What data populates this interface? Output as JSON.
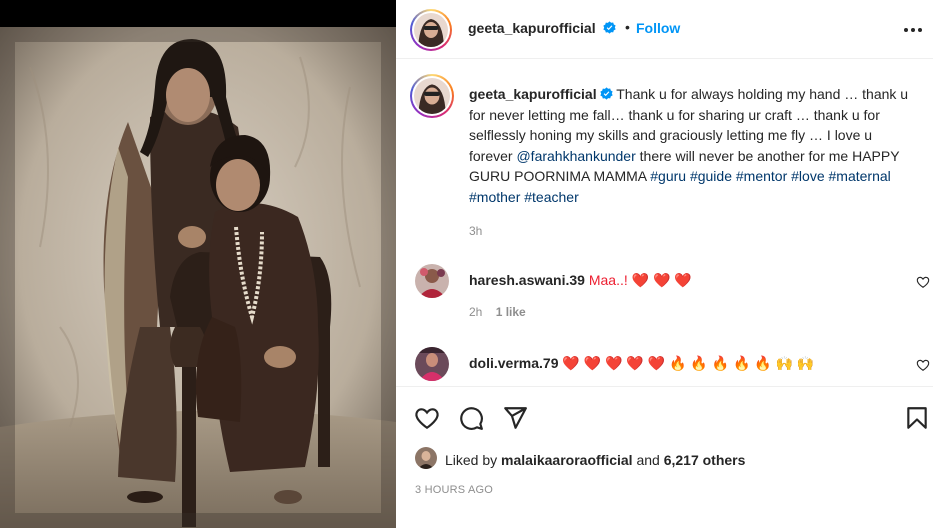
{
  "header": {
    "username": "geeta_kapurofficial",
    "separator": "•",
    "follow_label": "Follow",
    "more_icon": "more-horizontal-icon"
  },
  "caption": {
    "username": "geeta_kapurofficial",
    "text_1": "Thank u for always holding my hand … thank u for never letting me fall… thank u for sharing ur craft … thank u for selflessly honing my skills and graciously letting me fly … I love u forever",
    "mention": "@farahkhankunder",
    "text_2": "there will never be another for me HAPPY GURU POORNIMA MAMMA",
    "hashtags": [
      "#guru",
      "#guide",
      "#mentor",
      "#love",
      "#maternal",
      "#mother",
      "#teacher"
    ],
    "time": "3h"
  },
  "comments": [
    {
      "username": "haresh.aswani.39",
      "text": "Maa..! ❤️ ❤️ ❤️",
      "time": "2h",
      "likes": "1 like"
    },
    {
      "username": "doli.verma.79",
      "text": "❤️ ❤️ ❤️ ❤️ ❤️ 🔥 🔥 🔥 🔥 🔥 🙌 🙌"
    }
  ],
  "actions": {
    "icons": [
      "heart-icon",
      "comment-icon",
      "share-icon",
      "bookmark-icon"
    ],
    "liked_by_prefix": "Liked by",
    "liked_by_user": "malaikaaroraofficial",
    "liked_by_and": "and",
    "liked_by_count": "6,217 others",
    "post_time": "3 HOURS AGO"
  },
  "colors": {
    "follow": "#0095f6",
    "verified": "#0095f6",
    "link": "#00376b",
    "heart_emoji": "#ed1f31",
    "secondary_text": "#8e8e8e"
  }
}
